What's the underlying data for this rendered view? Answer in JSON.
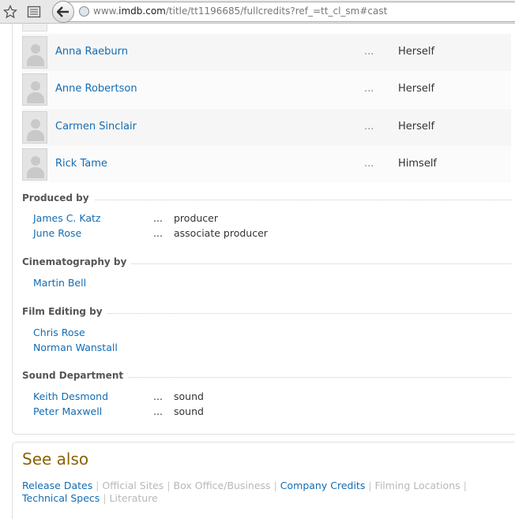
{
  "browser": {
    "url_prefix": "www.",
    "url_domain": "imdb.com",
    "url_path": "/title/tt1196685/fullcredits?ref_=tt_cl_sm#cast"
  },
  "cast": [
    {
      "name": "Anna Raeburn",
      "dots": "...",
      "character": "Herself"
    },
    {
      "name": "Anne Robertson",
      "dots": "...",
      "character": "Herself"
    },
    {
      "name": "Carmen Sinclair",
      "dots": "...",
      "character": "Herself"
    },
    {
      "name": "Rick Tame",
      "dots": "...",
      "character": "Himself"
    }
  ],
  "sections": {
    "produced": {
      "title": "Produced by",
      "rows": [
        {
          "name": "James C. Katz",
          "dots": "...",
          "credit": "producer"
        },
        {
          "name": "June Rose",
          "dots": "...",
          "credit": "associate producer"
        }
      ]
    },
    "cinematography": {
      "title": "Cinematography by",
      "rows": [
        {
          "name": "Martin Bell"
        }
      ]
    },
    "editing": {
      "title": "Film Editing by",
      "rows": [
        {
          "name": "Chris Rose"
        },
        {
          "name": "Norman Wanstall"
        }
      ]
    },
    "sound": {
      "title": "Sound Department",
      "rows": [
        {
          "name": "Keith Desmond",
          "dots": "...",
          "credit": "sound"
        },
        {
          "name": "Peter Maxwell",
          "dots": "...",
          "credit": "sound"
        }
      ]
    }
  },
  "see_also": {
    "title": "See also",
    "links": [
      {
        "label": "Release Dates",
        "active": true
      },
      {
        "label": "Official Sites",
        "active": false
      },
      {
        "label": "Box Office/Business",
        "active": false
      },
      {
        "label": "Company Credits",
        "active": true
      },
      {
        "label": "Filming Locations",
        "active": false
      },
      {
        "label": "Technical Specs",
        "active": true
      },
      {
        "label": "Literature",
        "active": false
      }
    ],
    "separator": "|"
  },
  "colors": {
    "link": "#136cb2",
    "see_also_title": "#8a6300",
    "disabled_link": "#b8b8b8"
  }
}
